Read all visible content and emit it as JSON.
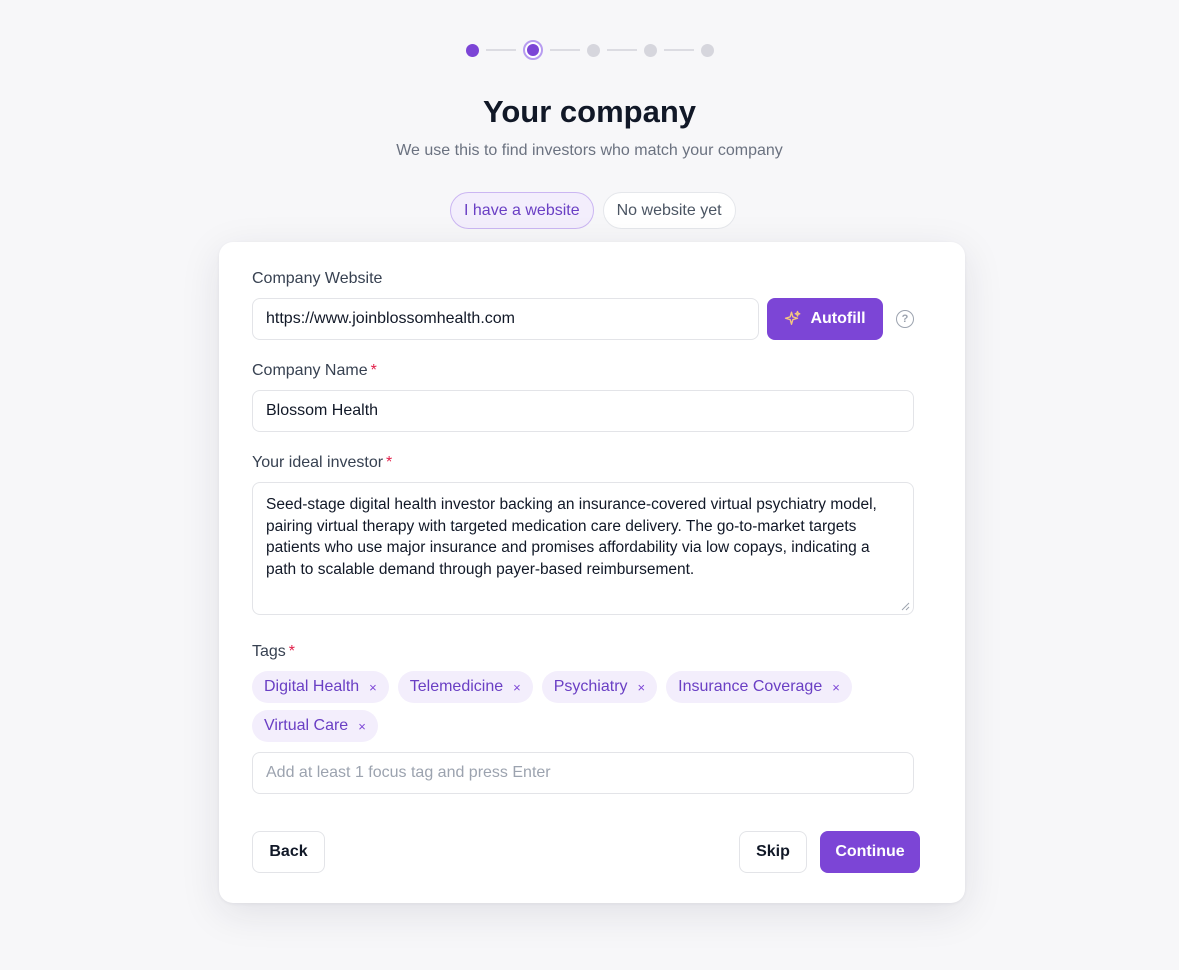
{
  "header": {
    "title": "Your company",
    "subtitle": "We use this to find investors who match your company"
  },
  "stepper": {
    "total": 5,
    "current": 2
  },
  "mode_toggle": {
    "with_website": "I have a website",
    "no_website": "No website yet",
    "selected": "with_website"
  },
  "website": {
    "label": "Company Website",
    "value": "https://www.joinblossomhealth.com",
    "autofill_label": "Autofill",
    "help_icon": "question-icon"
  },
  "company_name": {
    "label": "Company Name",
    "required": "*",
    "value": "Blossom Health"
  },
  "ideal_investor": {
    "label": "Your ideal investor",
    "required": "*",
    "value": "Seed-stage digital health investor backing an insurance-covered virtual psychiatry model, pairing virtual therapy with targeted medication care delivery. The go-to-market targets patients who use major insurance and promises affordability via low copays, indicating a path to scalable demand through payer-based reimbursement."
  },
  "tags": {
    "label": "Tags",
    "required": "*",
    "items": [
      "Digital Health",
      "Telemedicine",
      "Psychiatry",
      "Insurance Coverage",
      "Virtual Care"
    ],
    "remove_glyph": "×",
    "input_placeholder": "Add at least 1 focus tag and press Enter"
  },
  "actions": {
    "back": "Back",
    "skip": "Skip",
    "continue": "Continue"
  },
  "colors": {
    "accent": "#7c45d6",
    "accent_soft": "#f3eefc",
    "required": "#e11d48"
  }
}
